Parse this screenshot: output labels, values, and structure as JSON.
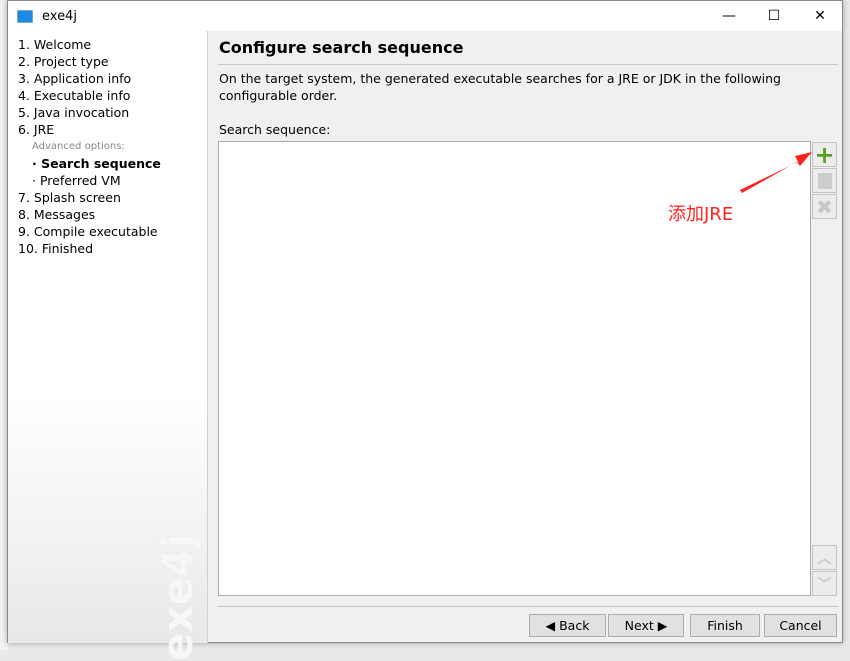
{
  "window": {
    "title": "exe4j",
    "minimize": "—",
    "maximize": "☐",
    "close": "✕"
  },
  "sidebar": {
    "steps": [
      "1. Welcome",
      "2. Project type",
      "3. Application info",
      "4. Executable info",
      "5. Java invocation",
      "6. JRE"
    ],
    "advanced_label": "Advanced options:",
    "sub_steps": [
      "Search sequence",
      "Preferred VM"
    ],
    "steps_after": [
      "7. Splash screen",
      "8. Messages",
      "9. Compile executable",
      "10. Finished"
    ],
    "active": "Search sequence",
    "watermark": "exe4j"
  },
  "main": {
    "title": "Configure search sequence",
    "description": "On the target system, the generated executable searches for a JRE or JDK in the following configurable order.",
    "list_label": "Search sequence:",
    "items": []
  },
  "side_buttons": {
    "add": "add-icon",
    "edit": "edit-icon",
    "remove": "remove-icon",
    "up": "up-icon",
    "down": "down-icon"
  },
  "footer": {
    "back": "Back",
    "next": "Next",
    "finish": "Finish",
    "cancel": "Cancel"
  },
  "annotation": {
    "text": "添加JRE",
    "color": "#ff2222"
  },
  "colors": {
    "add_green": "#5aa01e"
  }
}
